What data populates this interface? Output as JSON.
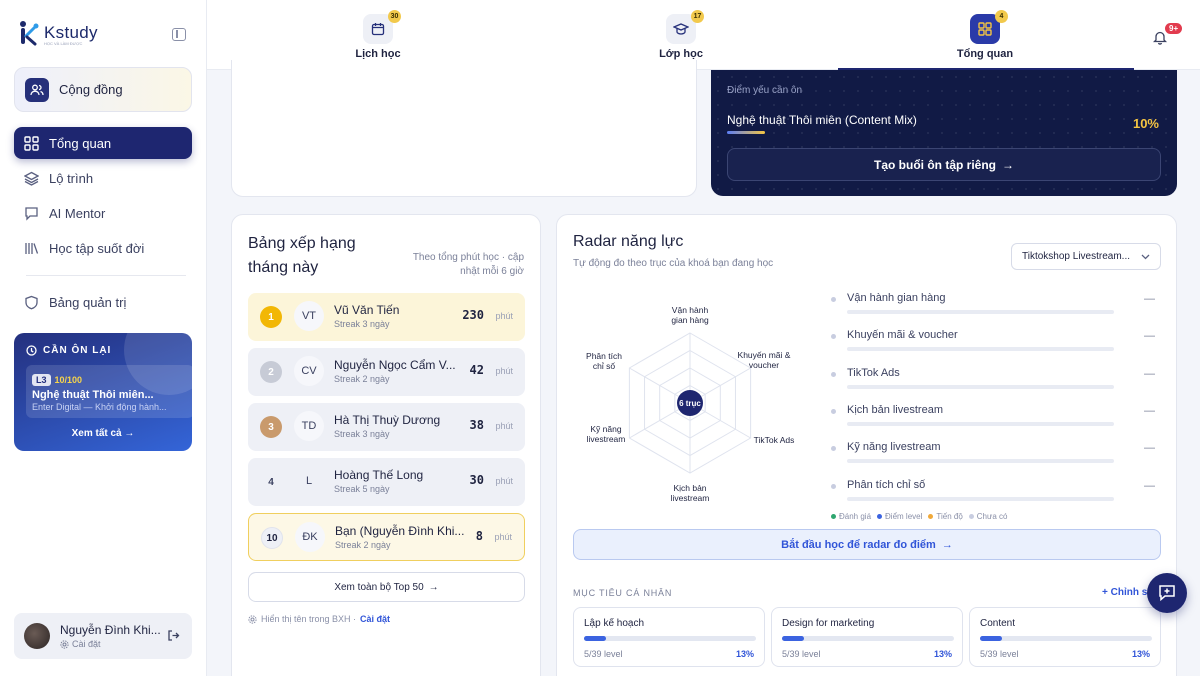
{
  "brand": {
    "name": "Kstudy",
    "tagline": "HỌC VÀ LÀM ĐƯỢC",
    "accent": "#1e2670"
  },
  "sidebar": {
    "community": "Cộng đồng",
    "nav": [
      {
        "label": "Tổng quan",
        "icon": "grid-icon",
        "active": true
      },
      {
        "label": "Lộ trình",
        "icon": "layers-icon"
      },
      {
        "label": "AI Mentor",
        "icon": "chat-icon"
      },
      {
        "label": "Học tập suốt đời",
        "icon": "library-icon"
      },
      {
        "label": "Bảng quản trị",
        "icon": "shield-icon"
      }
    ],
    "review": {
      "heading": "CẦN ÔN LẠI",
      "level": "L3",
      "score": "10/100",
      "title": "Nghệ thuật Thôi miên...",
      "subtitle": "Enter Digital — Khởi động hành...",
      "view_all": "Xem tất cả"
    },
    "user": {
      "name": "Nguyễn Đình Khi...",
      "settings": "Cài đặt"
    }
  },
  "topbar": {
    "tabs": [
      {
        "label": "Lịch học",
        "count": "30",
        "icon": "calendar-icon"
      },
      {
        "label": "Lớp học",
        "count": "17",
        "icon": "graduation-cap-icon"
      },
      {
        "label": "Tổng quan",
        "count": "4",
        "icon": "grid-icon",
        "active": true
      }
    ],
    "notifications": "9+"
  },
  "weak_points": {
    "label": "Điểm yếu cần ôn",
    "topic": "Nghệ thuật Thôi miên (Content Mix)",
    "percent": "10%",
    "progress": 0.1,
    "button": "Tạo buổi ôn tập riêng"
  },
  "leaderboard": {
    "title": "Bảng xếp hạng tháng này",
    "note": "Theo tổng phút học · cập nhật mỗi 6 giờ",
    "unit": "phút",
    "rows": [
      {
        "rank": "1",
        "initials": "VT",
        "name": "Vũ Văn Tiến",
        "streak": "Streak 3 ngày",
        "minutes": "230"
      },
      {
        "rank": "2",
        "initials": "CV",
        "name": "Nguyễn Ngọc Cẩm V...",
        "streak": "Streak 2 ngày",
        "minutes": "42"
      },
      {
        "rank": "3",
        "initials": "TD",
        "name": "Hà Thị Thuỳ Dương",
        "streak": "Streak 3 ngày",
        "minutes": "38"
      },
      {
        "rank": "4",
        "initials": "L",
        "name": "Hoàng Thế Long",
        "streak": "Streak 5 ngày",
        "minutes": "30"
      },
      {
        "rank": "10",
        "initials": "ĐK",
        "name": "Bạn (Nguyễn Đình Khi...",
        "streak": "Streak 2 ngày",
        "minutes": "8"
      }
    ],
    "top50_button": "Xem toàn bộ Top 50",
    "footer_text": "Hiển thị tên trong BXH ·",
    "footer_link": "Cài đặt"
  },
  "radar": {
    "title": "Radar năng lực",
    "subtitle": "Tự động đo theo trục của khoá bạn đang học",
    "course": "Tiktokshop Livestream...",
    "center_label": "6 trục",
    "axis_labels": [
      "Vận hành gian hàng",
      "Khuyến mãi & voucher",
      "TikTok Ads",
      "Kịch bản livestream",
      "Kỹ năng livestream",
      "Phân tích chỉ số"
    ],
    "axes": [
      {
        "name": "Vận hành gian hàng",
        "value": "—"
      },
      {
        "name": "Khuyến mãi & voucher",
        "value": "—"
      },
      {
        "name": "TikTok Ads",
        "value": "—"
      },
      {
        "name": "Kịch bản livestream",
        "value": "—"
      },
      {
        "name": "Kỹ năng livestream",
        "value": "—"
      },
      {
        "name": "Phân tích chỉ số",
        "value": "—"
      }
    ],
    "legend": [
      {
        "label": "Đánh giá",
        "color": "#2ea66f"
      },
      {
        "label": "Điểm level",
        "color": "#3b63e0"
      },
      {
        "label": "Tiến độ",
        "color": "#f0a93a"
      },
      {
        "label": "Chưa có",
        "color": "#c8cde0"
      }
    ],
    "start_button": "Bắt đầu học để radar đo điểm"
  },
  "goals": {
    "label": "MỤC TIÊU CÁ NHÂN",
    "edit": "+ Chỉnh sửa",
    "items": [
      {
        "name": "Lập kế hoạch",
        "level": "5/39 level",
        "percent": "13%",
        "progress": 0.13
      },
      {
        "name": "Design for marketing",
        "level": "5/39 level",
        "percent": "13%",
        "progress": 0.13
      },
      {
        "name": "Content",
        "level": "5/39 level",
        "percent": "13%",
        "progress": 0.13
      }
    ]
  }
}
